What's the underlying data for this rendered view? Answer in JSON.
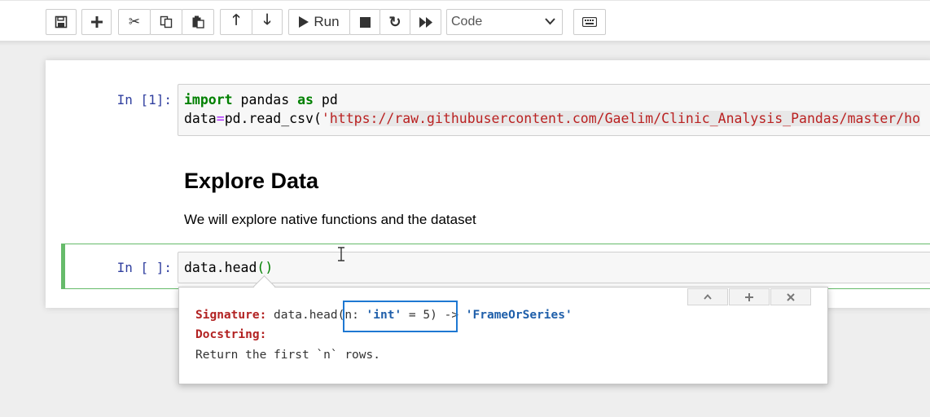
{
  "toolbar": {
    "run_label": "Run",
    "celltype_value": "Code",
    "buttons": [
      "save-icon",
      "plus-icon",
      "cut-icon",
      "copy-icon",
      "paste-icon",
      "arrow-up-icon",
      "arrow-down-icon",
      "run-icon",
      "stop-icon",
      "restart-icon",
      "fast-forward-icon",
      "keyboard-icon"
    ]
  },
  "cells": {
    "cell1": {
      "prompt": "In [1]:",
      "line1": {
        "kw1": "import",
        "mid": " pandas ",
        "kw2": "as",
        "end": " pd"
      },
      "line2": {
        "pre": "data",
        "eq": "=",
        "call": "pd.read_csv(",
        "quote": "'",
        "url": "https://raw.githubusercontent.com/Gaelim/Clinic_Analysis_Pandas/master/ho"
      }
    },
    "markdown": {
      "heading": "Explore Data",
      "paragraph": "We will explore native functions and the dataset"
    },
    "cell2": {
      "prompt": "In [ ]:",
      "code_prefix": "data.head",
      "paren_open": "(",
      "paren_close": ")"
    }
  },
  "tooltip": {
    "signature_label": "Signature:",
    "signature_name": " data.hea",
    "signature_d": "d",
    "signature_params_open": "(n: ",
    "signature_type": "'int'",
    "signature_default": " = 5)",
    "signature_arrow": " -> ",
    "signature_return": "'FrameOrSeries'",
    "docstring_label": "Docstring:",
    "docstring_text": "Return the first `n` rows.",
    "buttons": [
      "chevron-up-icon",
      "plus-icon",
      "close-icon"
    ]
  }
}
